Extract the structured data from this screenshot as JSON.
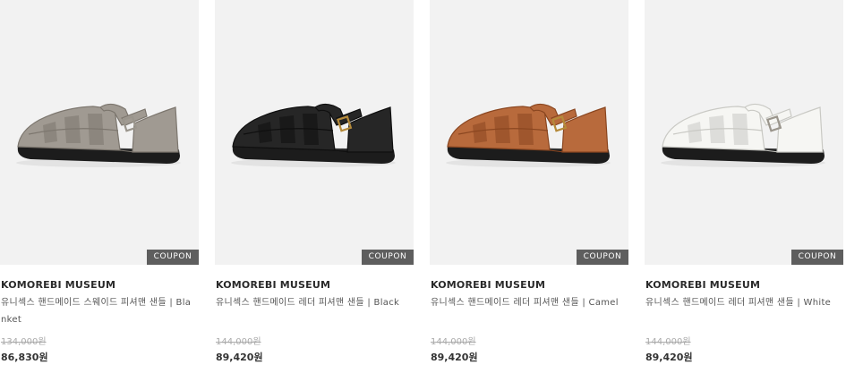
{
  "products": [
    {
      "brand": "KOMOREBI MUSEUM",
      "name": "유니섹스 핸드메이드 스웨이드 피셔맨 샌들 | Blanket",
      "original_price": "134,000원",
      "sale_price": "86,830원",
      "badge": "COUPON",
      "color": "#a09a92",
      "color_dark": "#7c766e",
      "image_icon": "sandal-image"
    },
    {
      "brand": "KOMOREBI MUSEUM",
      "name": "유니섹스 핸드메이드 레더 피셔맨 샌들 | Black",
      "original_price": "144,000원",
      "sale_price": "89,420원",
      "badge": "COUPON",
      "color": "#262626",
      "color_dark": "#0f0f0f",
      "image_icon": "sandal-image"
    },
    {
      "brand": "KOMOREBI MUSEUM",
      "name": "유니섹스 핸드메이드 레더 피셔맨 샌들 | Camel",
      "original_price": "144,000원",
      "sale_price": "89,420원",
      "badge": "COUPON",
      "color": "#b86a3c",
      "color_dark": "#8a4620",
      "image_icon": "sandal-image"
    },
    {
      "brand": "KOMOREBI MUSEUM",
      "name": "유니섹스 핸드메이드 레더 피셔맨 샌들 | White",
      "original_price": "144,000원",
      "sale_price": "89,420원",
      "badge": "COUPON",
      "color": "#f6f6f3",
      "color_dark": "#c9c9c4",
      "image_icon": "sandal-image"
    }
  ]
}
